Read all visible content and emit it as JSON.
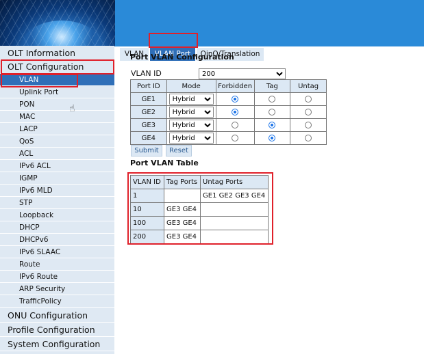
{
  "sidebar": {
    "top_items": [
      {
        "label": "OLT Information"
      },
      {
        "label": "OLT Configuration"
      }
    ],
    "sub_items": [
      {
        "label": "VLAN",
        "selected": true
      },
      {
        "label": "Uplink Port"
      },
      {
        "label": "PON"
      },
      {
        "label": "MAC"
      },
      {
        "label": "LACP"
      },
      {
        "label": "QoS"
      },
      {
        "label": "ACL"
      },
      {
        "label": "IPv6 ACL"
      },
      {
        "label": "IGMP"
      },
      {
        "label": "IPv6 MLD"
      },
      {
        "label": "STP"
      },
      {
        "label": "Loopback"
      },
      {
        "label": "DHCP"
      },
      {
        "label": "DHCPv6"
      },
      {
        "label": "IPv6 SLAAC"
      },
      {
        "label": "Route"
      },
      {
        "label": "IPv6 Route"
      },
      {
        "label": "ARP Security"
      },
      {
        "label": "TrafficPolicy"
      }
    ],
    "bottom_items": [
      {
        "label": "ONU Configuration"
      },
      {
        "label": "Profile Configuration"
      },
      {
        "label": "System Configuration"
      }
    ]
  },
  "tabs": [
    {
      "label": "VLAN",
      "active": false
    },
    {
      "label": "VLAN Port",
      "active": true
    },
    {
      "label": "QinQ/Translation",
      "active": false
    }
  ],
  "port_vlan_config": {
    "title": "Port VLAN Configuration",
    "vlan_id_label": "VLAN ID",
    "vlan_id_value": "200",
    "columns": [
      "Port ID",
      "Mode",
      "Forbidden",
      "Tag",
      "Untag"
    ],
    "rows": [
      {
        "port": "GE1",
        "mode": "Hybrid",
        "selection": "Forbidden"
      },
      {
        "port": "GE2",
        "mode": "Hybrid",
        "selection": "Forbidden"
      },
      {
        "port": "GE3",
        "mode": "Hybrid",
        "selection": "Tag"
      },
      {
        "port": "GE4",
        "mode": "Hybrid",
        "selection": "Tag"
      }
    ],
    "submit_label": "Submit",
    "reset_label": "Reset"
  },
  "port_vlan_table": {
    "title": "Port VLAN Table",
    "columns": [
      "VLAN ID",
      "Tag Ports",
      "Untag Ports"
    ],
    "rows": [
      {
        "vlan_id": "1",
        "tag_ports": "",
        "untag_ports": "GE1 GE2 GE3 GE4"
      },
      {
        "vlan_id": "10",
        "tag_ports": "GE3 GE4",
        "untag_ports": ""
      },
      {
        "vlan_id": "100",
        "tag_ports": "GE3 GE4",
        "untag_ports": ""
      },
      {
        "vlan_id": "200",
        "tag_ports": "GE3 GE4",
        "untag_ports": ""
      }
    ]
  },
  "colors": {
    "header_blue": "#2a8ad8",
    "selected_blue": "#2f6fb8",
    "light_blue": "#dce8f4",
    "highlight_red": "#e0202a"
  }
}
